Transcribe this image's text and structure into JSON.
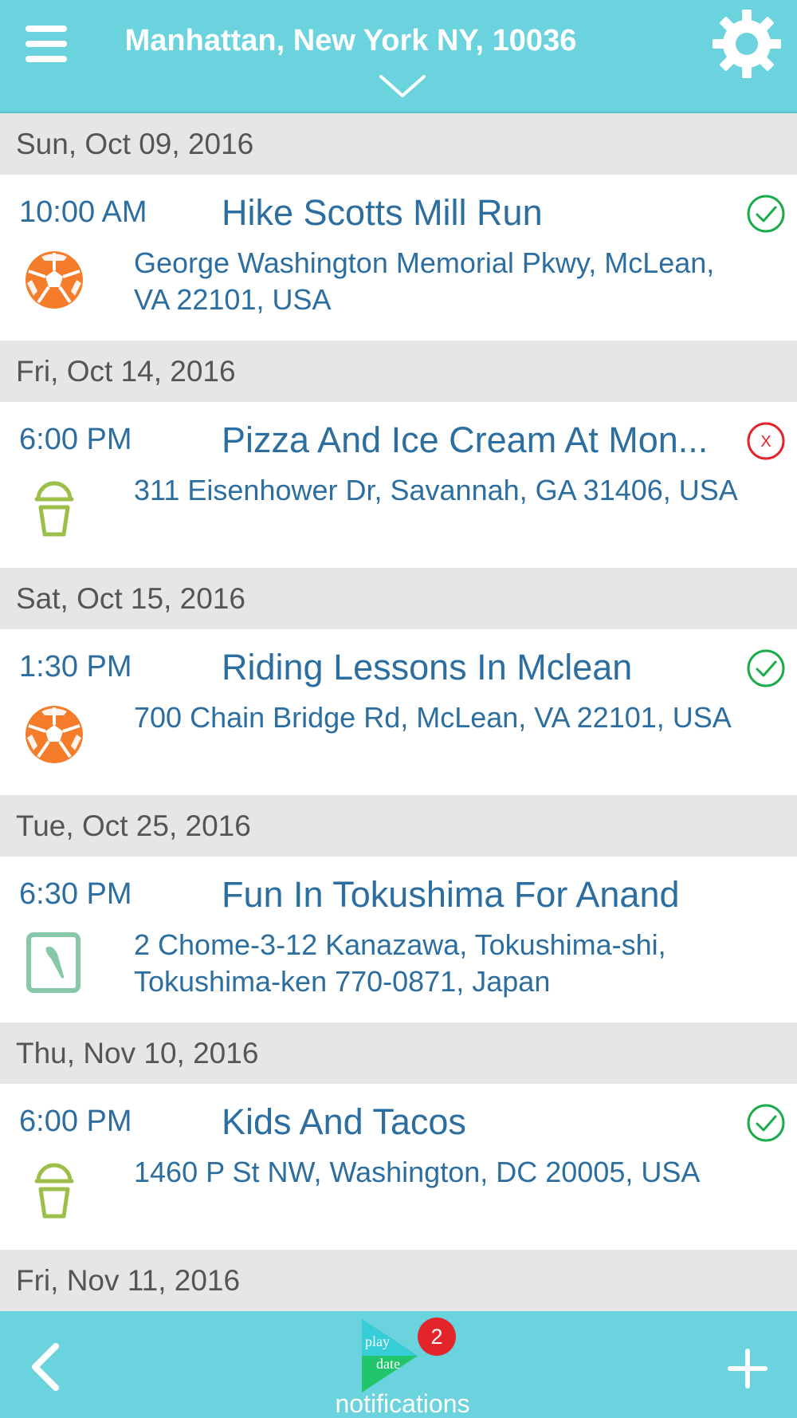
{
  "header": {
    "location": "Manhattan, New York NY, 10036",
    "menu_icon": "hamburger-menu-icon",
    "dropdown_icon": "chevron-down-icon",
    "settings_icon": "gear-icon",
    "background_color": "#6bd3dd"
  },
  "days": [
    {
      "date": "Sun, Oct 09, 2016",
      "event": {
        "time": "10:00 AM",
        "title": "Hike Scotts Mill Run",
        "address": "George Washington Memorial Pkwy, McLean, VA 22101, USA",
        "category_icon": "soccer-ball-icon",
        "status": "accepted",
        "status_icon": "check-circle-icon"
      }
    },
    {
      "date": "Fri, Oct 14, 2016",
      "event": {
        "time": "6:00 PM",
        "title": "Pizza And Ice Cream At Mon...",
        "address": "311 Eisenhower Dr, Savannah, GA 31406, USA",
        "category_icon": "ice-cream-icon",
        "status": "declined",
        "status_icon": "x-circle-icon",
        "status_text": "X"
      }
    },
    {
      "date": "Sat, Oct 15, 2016",
      "event": {
        "time": "1:30 PM",
        "title": "Riding Lessons In Mclean",
        "address": "700 Chain Bridge Rd, McLean, VA 22101, USA",
        "category_icon": "soccer-ball-icon",
        "status": "accepted",
        "status_icon": "check-circle-icon"
      }
    },
    {
      "date": "Tue, Oct 25, 2016",
      "event": {
        "time": "6:30 PM",
        "title": "Fun In Tokushima For Anand",
        "address": "2 Chome-3-12 Kanazawa, Tokushima-shi, Tokushima-ken 770-0871, Japan",
        "category_icon": "art-brush-icon",
        "status": "none"
      }
    },
    {
      "date": "Thu, Nov 10, 2016",
      "event": {
        "time": "6:00 PM",
        "title": "Kids And Tacos",
        "address": "1460 P St NW, Washington, DC 20005, USA",
        "category_icon": "ice-cream-icon",
        "status": "accepted",
        "status_icon": "check-circle-icon"
      }
    },
    {
      "date": "Fri, Nov 11, 2016"
    }
  ],
  "footer": {
    "back_icon": "chevron-left-icon",
    "add_icon": "plus-icon",
    "notifications_logo": {
      "line1": "play",
      "line2": "date"
    },
    "notifications_badge": "2",
    "notifications_label": "notifications"
  },
  "colors": {
    "accent": "#6bd3dd",
    "text_blue": "#2c6e9f",
    "date_band": "#e6e6e6",
    "accepted_green": "#1aab4a",
    "declined_red": "#e3242b",
    "soccer_orange": "#f47c2a",
    "ice_cream_green": "#9cbf4a",
    "art_green": "#86c8a8"
  }
}
